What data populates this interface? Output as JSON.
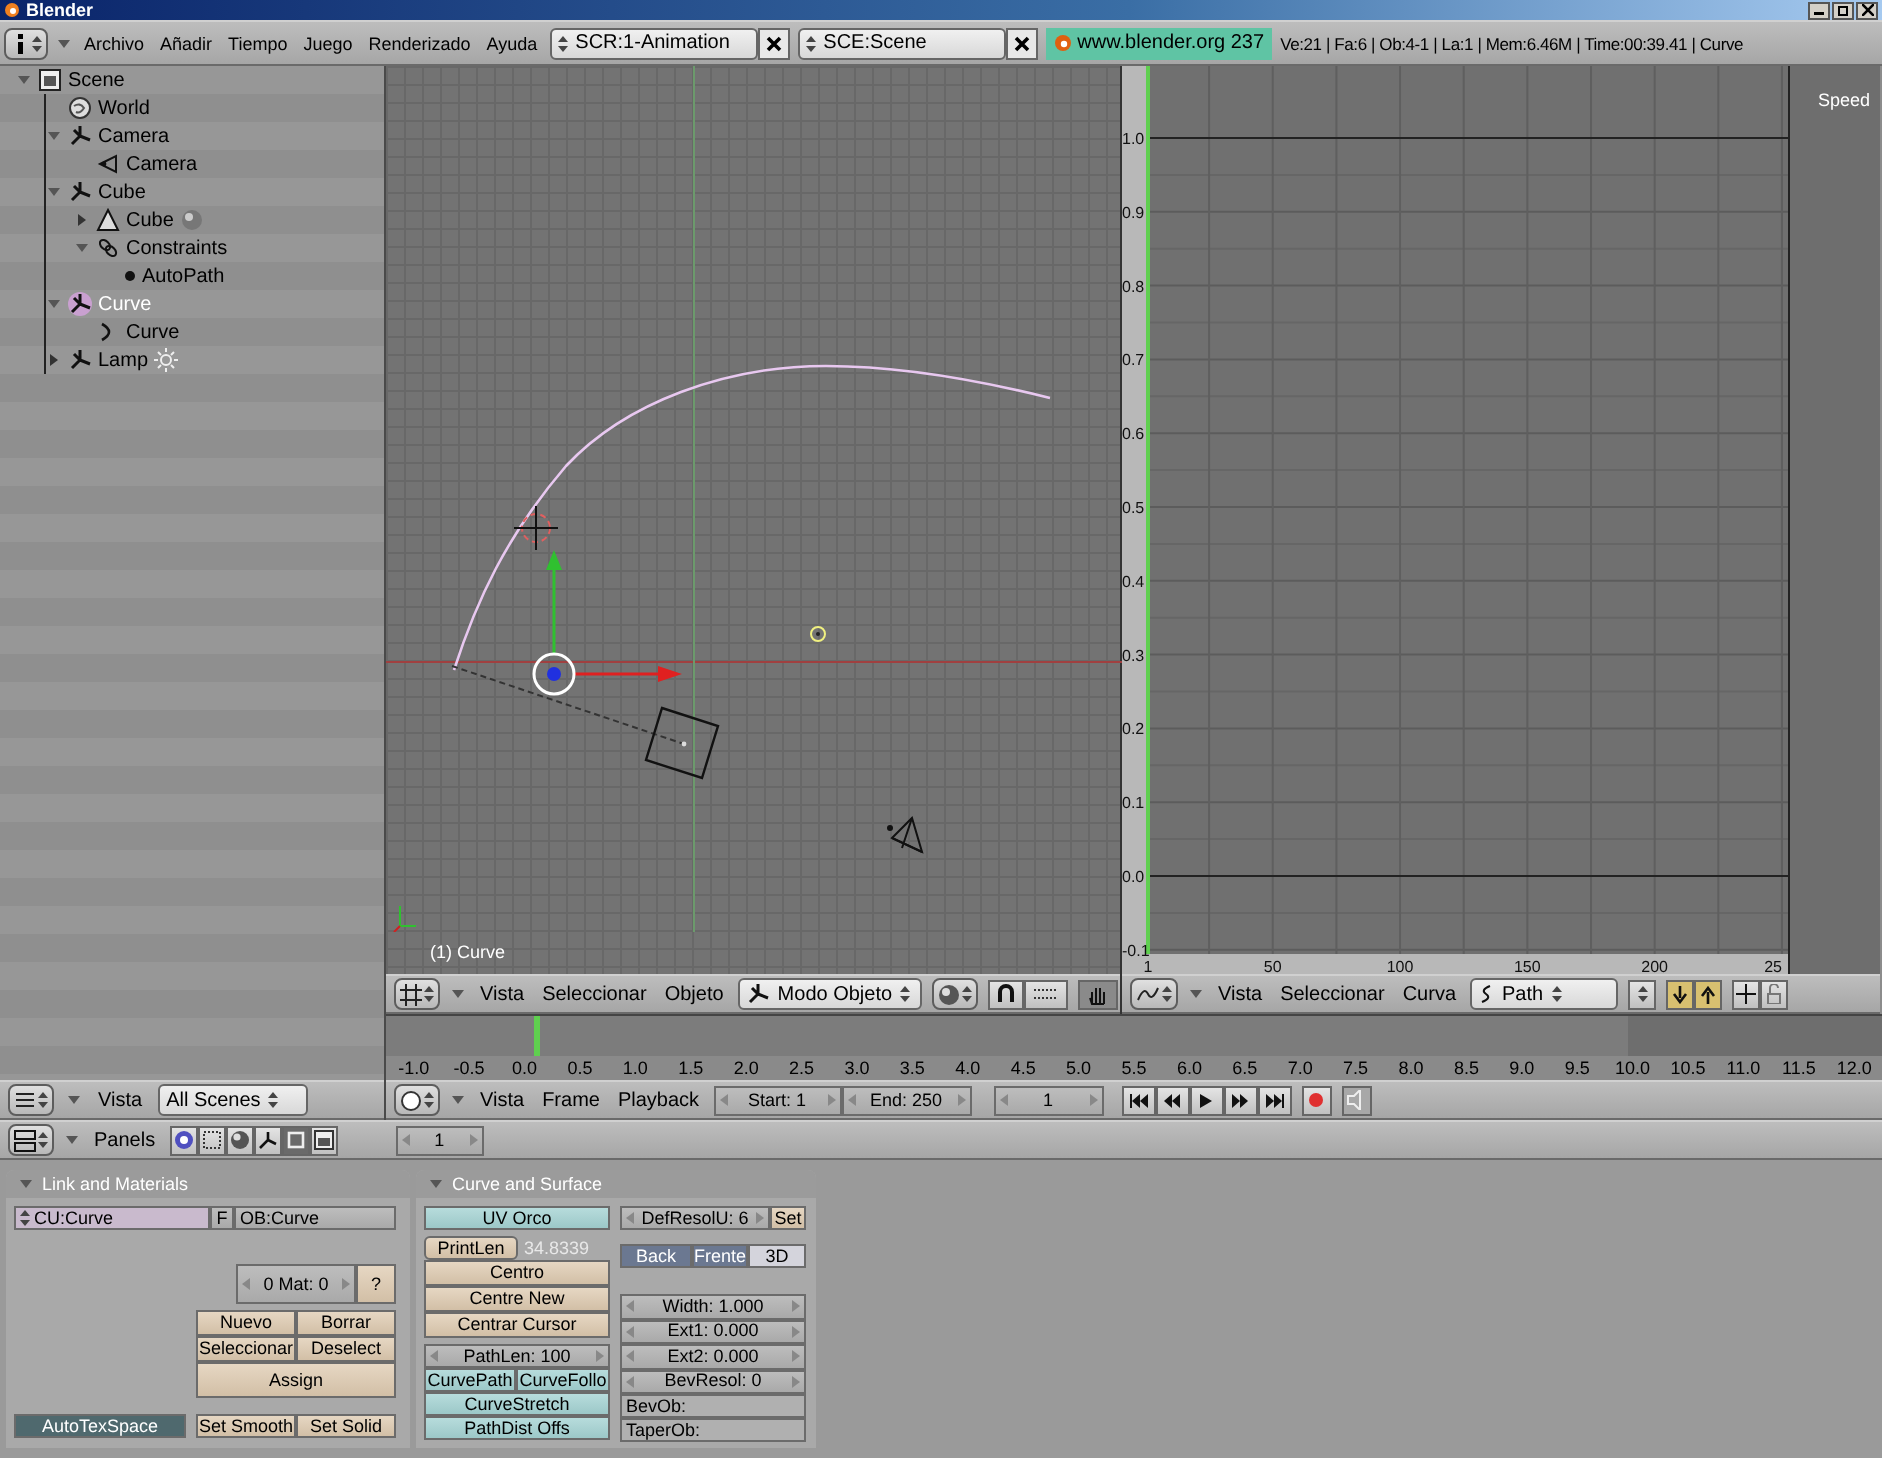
{
  "window": {
    "title": "Blender"
  },
  "info_header": {
    "menus": [
      "Archivo",
      "Añadir",
      "Tiempo",
      "Juego",
      "Renderizado",
      "Ayuda"
    ],
    "screen": "SCR:1-Animation",
    "scene": "SCE:Scene",
    "website": "www.blender.org 237",
    "stats": "Ve:21 | Fa:6 | Ob:4-1 | La:1 | Mem:6.46M | Time:00:39.41 | Curve"
  },
  "outliner": {
    "items": [
      {
        "label": "Scene",
        "kind": "scene",
        "expanded": true,
        "selected": false,
        "children": [
          {
            "label": "World",
            "kind": "world",
            "selected": false
          },
          {
            "label": "Camera",
            "kind": "object",
            "expanded": true,
            "selected": false,
            "children": [
              {
                "label": "Camera",
                "kind": "camera",
                "selected": false
              }
            ]
          },
          {
            "label": "Cube",
            "kind": "object",
            "expanded": true,
            "selected": false,
            "children": [
              {
                "label": "Cube",
                "kind": "mesh",
                "expanded": false,
                "selected": false,
                "children": [
                  {
                    "kind": "material"
                  }
                ]
              },
              {
                "label": "Constraints",
                "kind": "constraints",
                "expanded": true,
                "selected": false,
                "children": [
                  {
                    "label": "AutoPath",
                    "kind": "constraint",
                    "selected": false
                  }
                ]
              }
            ]
          },
          {
            "label": "Curve",
            "kind": "object",
            "expanded": true,
            "selected": true,
            "children": [
              {
                "label": "Curve",
                "kind": "curve",
                "selected": false
              }
            ]
          },
          {
            "label": "Lamp",
            "kind": "object",
            "expanded": false,
            "selected": false,
            "children": [
              {
                "kind": "lamp"
              }
            ]
          }
        ]
      }
    ],
    "header": {
      "menu": "Vista",
      "scope": "All Scenes"
    }
  },
  "view3d": {
    "overlay": "(1) Curve",
    "header": {
      "menus": [
        "Vista",
        "Seleccionar",
        "Objeto"
      ],
      "mode": "Modo Objeto"
    }
  },
  "ipo": {
    "channel": "Speed",
    "y_labels": [
      "1.0",
      "0.9",
      "0.8",
      "0.7",
      "0.6",
      "0.5",
      "0.4",
      "0.3",
      "0.2",
      "0.1",
      "0.0",
      "-0.1"
    ],
    "x_labels": [
      "1",
      "50",
      "100",
      "150",
      "200",
      "25"
    ],
    "header": {
      "menus": [
        "Vista",
        "Seleccionar",
        "Curva"
      ],
      "ipo_type": "Path"
    }
  },
  "timeline": {
    "labels": [
      "-1.0",
      "-0.5",
      "0.0",
      "0.5",
      "1.0",
      "1.5",
      "2.0",
      "2.5",
      "3.0",
      "3.5",
      "4.0",
      "4.5",
      "5.0",
      "5.5",
      "6.0",
      "6.5",
      "7.0",
      "7.5",
      "8.0",
      "8.5",
      "9.0",
      "9.5",
      "10.0",
      "10.5",
      "11.0",
      "11.5",
      "12.0"
    ],
    "header": {
      "menus": [
        "Vista",
        "Frame",
        "Playback"
      ],
      "start": "Start: 1",
      "end": "End: 250",
      "frame": "1"
    }
  },
  "buttons_window": {
    "header": {
      "menu": "Panels",
      "contexts": [
        {
          "kind": "logic",
          "selected": false
        },
        {
          "kind": "script",
          "selected": false
        },
        {
          "kind": "shading",
          "selected": false
        },
        {
          "kind": "object",
          "selected": false
        },
        {
          "kind": "editing",
          "selected": true
        },
        {
          "kind": "scene",
          "selected": false
        }
      ],
      "frame": "1"
    },
    "link_materials": {
      "title": "Link and Materials",
      "curve_name": "CU:Curve",
      "fake_user": "F",
      "object_name": "OB:Curve",
      "material_index": "0 Mat: 0",
      "help": "?",
      "material_buttons": [
        "Nuevo",
        "Borrar",
        "Seleccionar",
        "Deselect"
      ],
      "assign": "Assign",
      "auto_tex_space": {
        "label": "AutoTexSpace",
        "on": true
      },
      "shading_buttons": [
        "Set Smooth",
        "Set Solid"
      ]
    },
    "curve_surface": {
      "title": "Curve and Surface",
      "uv_orco": {
        "label": "UV Orco",
        "on": false
      },
      "print_len": "PrintLen",
      "length": "34.8339",
      "centre_buttons": [
        "Centro",
        "Centre New",
        "Centrar Cursor"
      ],
      "path_len": "PathLen: 100",
      "path_toggles": [
        {
          "label": "CurvePath",
          "on": false
        },
        {
          "label": "CurveFollo",
          "on": false
        }
      ],
      "curve_stretch": {
        "label": "CurveStretch",
        "on": false
      },
      "path_dist_offs": {
        "label": "PathDist Offs",
        "on": false
      },
      "def_resol": "DefResolU: 6",
      "set": "Set",
      "fill_modes": [
        {
          "label": "Back",
          "selected": true
        },
        {
          "label": "Frente",
          "selected": true
        },
        {
          "label": "3D",
          "selected": false
        }
      ],
      "numeric_fields": [
        "Width: 1.000",
        "Ext1: 0.000",
        "Ext2: 0.000",
        "BevResol: 0"
      ],
      "bev_ob": "BevOb:",
      "taper_ob": "TaperOb:"
    }
  }
}
